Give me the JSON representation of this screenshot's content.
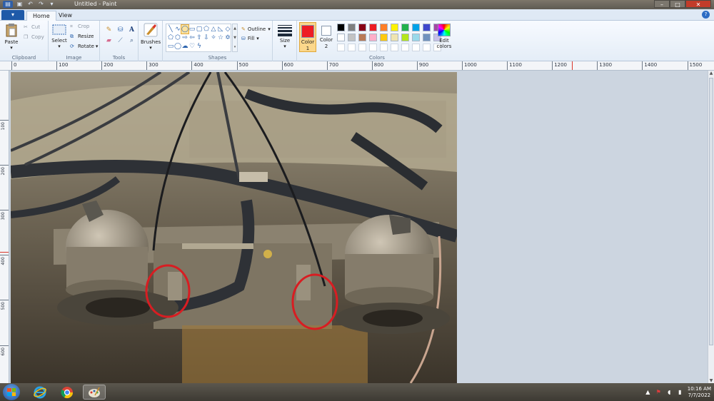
{
  "window": {
    "title": "Untitled - Paint",
    "controls": {
      "minimize": "–",
      "maximize": "□",
      "close": "✕"
    }
  },
  "tabs": {
    "file": "▾",
    "home": "Home",
    "view": "View"
  },
  "ribbon": {
    "clipboard": {
      "label": "Clipboard",
      "paste": "Paste",
      "cut": "Cut",
      "copy": "Copy"
    },
    "image": {
      "label": "Image",
      "select": "Select",
      "crop": "Crop",
      "resize": "Resize",
      "rotate": "Rotate"
    },
    "tools": {
      "label": "Tools"
    },
    "brushes": {
      "label": "Brushes"
    },
    "shapes": {
      "label": "Shapes",
      "outline": "Outline",
      "fill": "Fill"
    },
    "size": {
      "label": "Size"
    },
    "colors": {
      "label": "Colors",
      "color1": "Color 1",
      "color2": "Color 2",
      "edit": "Edit colors",
      "color1_value": "#ed1c24",
      "color2_value": "#ffffff",
      "palette_row1": [
        "#000000",
        "#7f7f7f",
        "#880015",
        "#ed1c24",
        "#ff7f27",
        "#fff200",
        "#22b14c",
        "#00a2e8",
        "#3f48cc",
        "#a349a4"
      ],
      "palette_row2": [
        "#ffffff",
        "#c3c3c3",
        "#b97a57",
        "#ffaec9",
        "#ffc90e",
        "#efe4b0",
        "#b5e61d",
        "#99d9ea",
        "#7092be",
        "#c8bfe7"
      ]
    }
  },
  "ruler": {
    "h_labels": [
      "0",
      "100",
      "200",
      "300",
      "400",
      "500",
      "600",
      "700",
      "800",
      "900",
      "1000",
      "1100",
      "1200",
      "1300",
      "1400",
      "1500"
    ],
    "v_labels": [
      "100",
      "200",
      "300",
      "400",
      "500",
      "600"
    ]
  },
  "taskbar": {
    "time": "10:16 AM",
    "date": "7/7/2022"
  }
}
